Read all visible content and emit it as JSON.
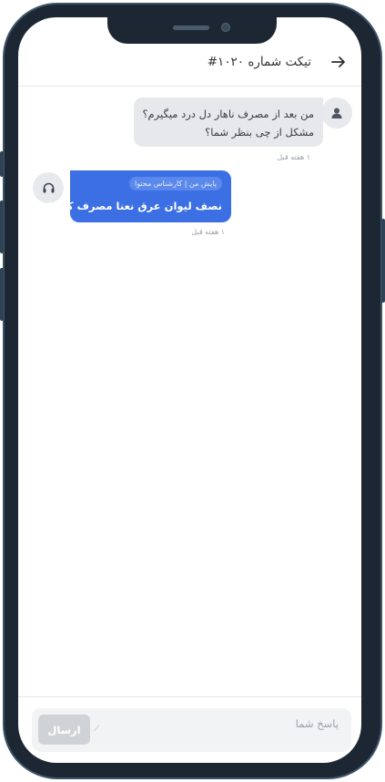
{
  "header": {
    "title": "تیکت شماره ۱۰۲۰#",
    "back_icon": "arrow-right-icon"
  },
  "messages": [
    {
      "sender": "user",
      "avatar_icon": "user-icon",
      "lines": [
        "من بعد از مصرف ناهار دل درد میگیرم؟",
        "مشکل از چی بنظر شما؟"
      ],
      "time": "۱ هفته قبل"
    },
    {
      "sender": "agent",
      "avatar_icon": "headset-icon",
      "badge": "پایش من | کارشناس محتوا",
      "text": "نصف لیوان عرق نعنا مصرف کنید!",
      "time": "۱ هفته قبل"
    }
  ],
  "reply": {
    "placeholder": "پاسخ شما",
    "send_label": "ارسال"
  },
  "colors": {
    "agent_bubble": "#3b6fe3",
    "user_bubble": "#e7e8eb",
    "send_disabled": "#cfd3d8"
  }
}
